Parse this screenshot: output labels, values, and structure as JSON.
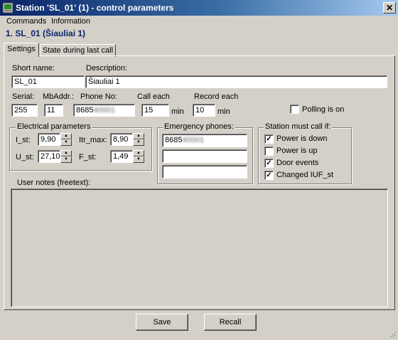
{
  "window": {
    "title": "Station 'SL_01' (1) - control parameters",
    "close_glyph": "✕"
  },
  "menu": [
    "Commands",
    "Information"
  ],
  "subtitle": "1. SL_01 (Šiauliai 1)",
  "tabs": [
    {
      "label": "Settings",
      "active": true
    },
    {
      "label": "State during last call",
      "active": false
    }
  ],
  "settings": {
    "short_name_label": "Short name:",
    "short_name_value": "SL_01",
    "description_label": "Description:",
    "description_value": "Šiauliai 1",
    "serial_label": "Serial:",
    "serial_value": "255",
    "mbaddr_label": "MbAddr.:",
    "mbaddr_value": "11",
    "phone_label": "Phone No:",
    "phone_value": "8685",
    "phone_redacted": "40001",
    "call_each_label": "Call each",
    "call_each_value": "15",
    "call_each_unit": "min",
    "record_each_label": "Record each",
    "record_each_value": "10",
    "record_each_unit": "min",
    "polling_label": "Polling is on",
    "polling_checked": false
  },
  "electrical": {
    "title": "Electrical parameters",
    "i_st_label": "I_st:",
    "i_st_value": "9,90",
    "itr_max_label": "Itr_max:",
    "itr_max_value": "8,90",
    "u_st_label": "U_st:",
    "u_st_value": "27,10",
    "f_st_label": "F_st:",
    "f_st_value": "1,49"
  },
  "emergency": {
    "title": "Emergency phones:",
    "phones": [
      "8685",
      "",
      ""
    ],
    "phone1_redacted": "40001"
  },
  "must_call": {
    "title": "Station must call if:",
    "items": [
      {
        "label": "Power is down",
        "checked": true
      },
      {
        "label": "Power is up",
        "checked": false
      },
      {
        "label": "Door events",
        "checked": true
      },
      {
        "label": "Changed IUF_st",
        "checked": true
      }
    ]
  },
  "notes": {
    "label": "User notes (freetext):",
    "value": ""
  },
  "buttons": {
    "save": "Save",
    "recall": "Recall"
  },
  "glyphs": {
    "up": "▲",
    "down": "▼",
    "check": "✓"
  }
}
